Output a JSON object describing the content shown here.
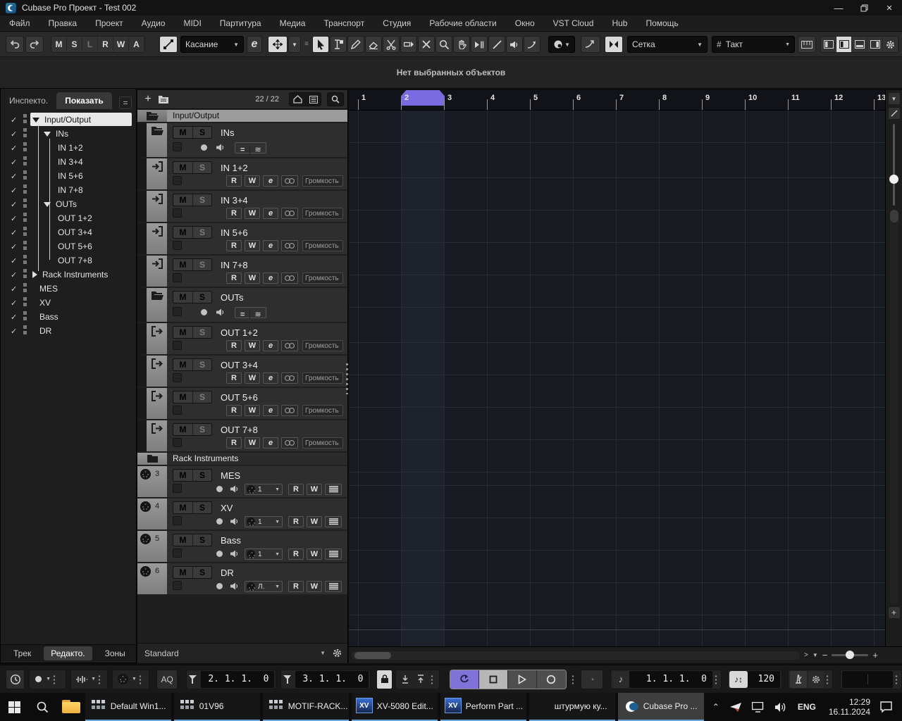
{
  "titlebar": {
    "title": "Cubase Pro Проект - Test 002",
    "window_buttons": [
      "minimize",
      "restore",
      "close"
    ]
  },
  "menubar": [
    "Файл",
    "Правка",
    "Проект",
    "Аудио",
    "MIDI",
    "Партитура",
    "Медиа",
    "Транспорт",
    "Студия",
    "Рабочие области",
    "Окно",
    "VST Cloud",
    "Hub",
    "Помощь"
  ],
  "toolbar": {
    "history": [
      "undo-icon",
      "redo-icon"
    ],
    "asio_buttons": [
      {
        "label": "M",
        "dim": false
      },
      {
        "label": "S",
        "dim": false
      },
      {
        "label": "L",
        "dim": true
      },
      {
        "label": "R",
        "dim": false
      },
      {
        "label": "W",
        "dim": false
      },
      {
        "label": "A",
        "dim": false
      }
    ],
    "automation_mode": "Касание",
    "edit_button": "e",
    "tools": [
      "object-selection-tool",
      "range-selection-tool",
      "draw-tool",
      "erase-tool",
      "split-tool",
      "glue-tool",
      "mute-tool",
      "zoom-tool",
      "hand-tool",
      "scrub-tool",
      "line-tool",
      "play-tool",
      "bend-tool"
    ],
    "selected_tool": "object-selection-tool",
    "snap_type": "Сетка",
    "grid_type": "Такт",
    "zone_buttons": [
      "left-zone-icon",
      "left-zone-active-icon",
      "lower-zone-icon",
      "right-zone-icon",
      "setup-gear-icon"
    ]
  },
  "info_line": {
    "status": "Нет выбранных объектов"
  },
  "visibility_panel": {
    "tabs": [
      "Инспекто.",
      "Показать"
    ],
    "active_tab": "Показать",
    "items": [
      {
        "label": "Input/Output",
        "level": 0,
        "expander": "open",
        "checked": true,
        "selected": true
      },
      {
        "label": "INs",
        "level": 1,
        "expander": "open",
        "checked": true
      },
      {
        "label": "IN 1+2",
        "level": 2,
        "checked": true
      },
      {
        "label": "IN 3+4",
        "level": 2,
        "checked": true
      },
      {
        "label": "IN 5+6",
        "level": 2,
        "checked": true
      },
      {
        "label": "IN 7+8",
        "level": 2,
        "checked": true
      },
      {
        "label": "OUTs",
        "level": 1,
        "expander": "open",
        "checked": true
      },
      {
        "label": "OUT 1+2",
        "level": 2,
        "checked": true
      },
      {
        "label": "OUT 3+4",
        "level": 2,
        "checked": true
      },
      {
        "label": "OUT 5+6",
        "level": 2,
        "checked": true
      },
      {
        "label": "OUT 7+8",
        "level": 2,
        "checked": true
      },
      {
        "label": "Rack Instruments",
        "level": 0,
        "expander": "closed",
        "checked": true
      },
      {
        "label": "MES",
        "level": 0,
        "checked": true
      },
      {
        "label": "XV",
        "level": 0,
        "checked": true
      },
      {
        "label": "Bass",
        "level": 0,
        "checked": true
      },
      {
        "label": "DR",
        "level": 0,
        "checked": true
      }
    ],
    "bottom_tabs": [
      "Трек",
      "Редакто.",
      "Зоны"
    ],
    "active_bottom_tab": "Редакто."
  },
  "track_list": {
    "count": "22 / 22",
    "volume_label": "Громкость",
    "mute_label": "M",
    "solo_label": "S",
    "read_label": "R",
    "write_label": "W",
    "edit_label": "e",
    "rows": [
      {
        "kind": "band",
        "shade": "light",
        "name": "Input/Output"
      },
      {
        "kind": "folder",
        "name": "INs"
      },
      {
        "kind": "audio",
        "dir": "in",
        "name": "IN 1+2"
      },
      {
        "kind": "audio",
        "dir": "in",
        "name": "IN 3+4"
      },
      {
        "kind": "audio",
        "dir": "in",
        "name": "IN 5+6"
      },
      {
        "kind": "audio",
        "dir": "in",
        "name": "IN 7+8"
      },
      {
        "kind": "folder",
        "name": "OUTs"
      },
      {
        "kind": "audio",
        "dir": "out",
        "name": "OUT 1+2"
      },
      {
        "kind": "audio",
        "dir": "out",
        "name": "OUT 3+4"
      },
      {
        "kind": "audio",
        "dir": "out",
        "name": "OUT 5+6"
      },
      {
        "kind": "audio",
        "dir": "out",
        "name": "OUT 7+8"
      },
      {
        "kind": "band",
        "shade": "dark",
        "name": "Rack Instruments"
      },
      {
        "kind": "midi",
        "num": "3",
        "name": "MES",
        "chan": "1"
      },
      {
        "kind": "midi",
        "num": "4",
        "name": "XV",
        "chan": "1"
      },
      {
        "kind": "midi",
        "num": "5",
        "name": "Bass",
        "chan": "1"
      },
      {
        "kind": "midi",
        "num": "6",
        "name": "DR",
        "chan": "Л."
      }
    ],
    "preset": "Standard"
  },
  "ruler": {
    "bars": [
      "1",
      "2",
      "3",
      "4",
      "5",
      "6",
      "7",
      "8",
      "9",
      "10",
      "11",
      "12",
      "13"
    ],
    "cycle_from_bar": "2",
    "cycle_to_bar": "3"
  },
  "transport": {
    "aq_label": "AQ",
    "left_locator": "2. 1. 1.  0",
    "right_locator": "3. 1. 1.  0",
    "position": "1. 1. 1.  0",
    "tempo": "120",
    "buttons": [
      "cycle",
      "stop",
      "play",
      "record"
    ],
    "active_button": "cycle"
  },
  "taskbar": {
    "apps": [
      {
        "label": "Default Win1...",
        "icon": "mixer-app-icon",
        "active": false
      },
      {
        "label": "01V96",
        "icon": "mixer-app-icon",
        "active": false
      },
      {
        "label": "MOTIF-RACK...",
        "icon": "mixer-app-icon",
        "active": false
      },
      {
        "label": "XV-5080 Edit...",
        "icon": "xv-app-icon",
        "active": false
      },
      {
        "label": "Perform Part ...",
        "icon": "xv-app-icon",
        "active": false
      },
      {
        "label": "штурмую ку...",
        "icon": "firefox-icon",
        "active": false
      },
      {
        "label": "Cubase Pro ...",
        "icon": "cubase-icon",
        "active": true
      }
    ],
    "tray": {
      "language": "ENG",
      "time": "12:29",
      "date": "16.11.2024"
    }
  },
  "colors": {
    "accent_purple": "#7a6ce0",
    "selection_white": "#d9d9d9",
    "taskbar_underline": "#6aa7d8"
  }
}
